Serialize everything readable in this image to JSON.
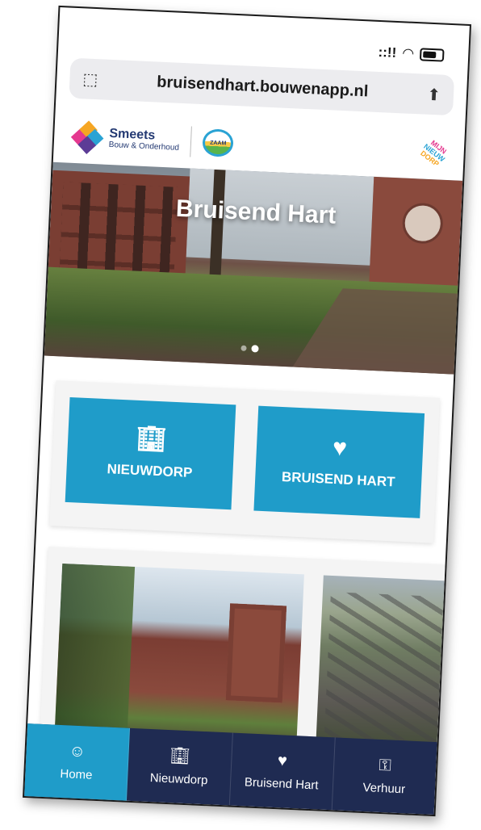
{
  "status": {
    "signal": "::!!",
    "wifi_icon": "wifi-icon",
    "battery_icon": "battery-icon"
  },
  "browser": {
    "url": "bruisendhart.bouwenapp.nl",
    "left_icon": "page-scan-icon",
    "share_icon": "share-icon"
  },
  "header": {
    "brand_title": "Smeets",
    "brand_sub": "Bouw & Onderhoud",
    "partner_logo_text": "ZAAM",
    "right_logo_lines": [
      "MIJN",
      "NIEUW",
      "DORP"
    ]
  },
  "hero": {
    "title": "Bruisend Hart",
    "slides": 2,
    "active_slide": 2
  },
  "tiles": [
    {
      "label": "NIEUWDORP",
      "icon": "building-icon"
    },
    {
      "label": "BRUISEND HART",
      "icon": "heart-icon"
    }
  ],
  "nav": [
    {
      "label": "Home",
      "icon": "users-icon",
      "active": true
    },
    {
      "label": "Nieuwdorp",
      "icon": "building-icon",
      "active": false
    },
    {
      "label": "Bruisend Hart",
      "icon": "heart-icon",
      "active": false
    },
    {
      "label": "Verhuur",
      "icon": "key-icon",
      "active": false
    }
  ],
  "colors": {
    "accent": "#1f9cc9",
    "nav_bg": "#1f2b52",
    "brand_text": "#243a73"
  }
}
